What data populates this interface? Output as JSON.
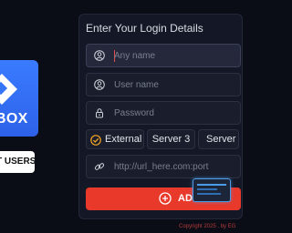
{
  "brand": {
    "logo_text": "BOX",
    "users_button_label": "T USERS"
  },
  "login_form": {
    "title": "Enter Your Login Details",
    "name_placeholder": "Any name",
    "username_placeholder": "User name",
    "password_placeholder": "Password",
    "server_options": [
      "External",
      "Server 3",
      "Server"
    ],
    "selected_server": "External",
    "url_placeholder": "http://url_here.com:port",
    "add_button_label": "ADD"
  },
  "footer": {
    "copyright": "Copyright 2025 . by EG"
  },
  "colors": {
    "background": "#0b0d16",
    "accent": "#e8392b",
    "brand_blue": "#3374f8",
    "check": "#f5a623"
  },
  "icons": [
    "user-icon",
    "user-icon",
    "lock-icon",
    "check-circle-icon",
    "link-icon",
    "plus-circle-icon"
  ]
}
